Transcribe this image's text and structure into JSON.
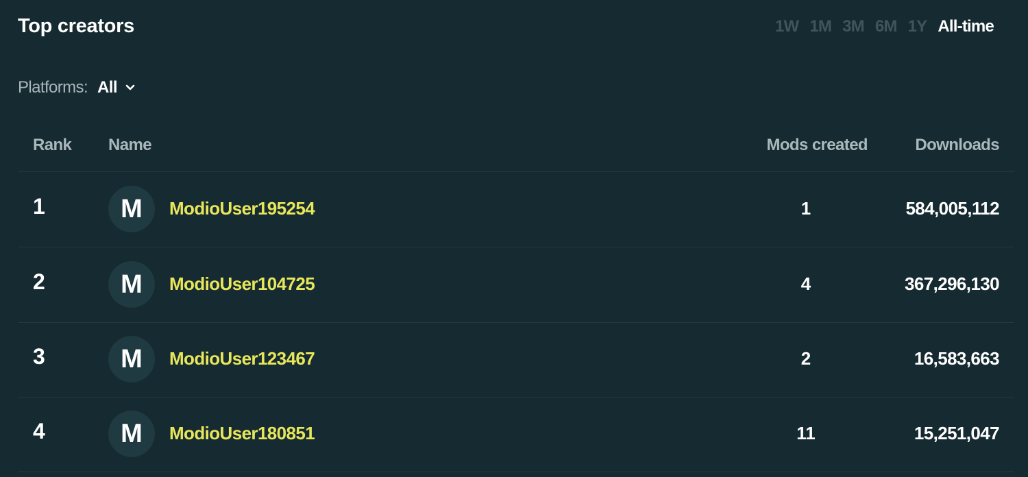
{
  "header": {
    "title": "Top creators",
    "ranges": [
      "1W",
      "1M",
      "3M",
      "6M",
      "1Y",
      "All-time"
    ],
    "active_range": "All-time"
  },
  "filter": {
    "label": "Platforms:",
    "value": "All"
  },
  "table": {
    "columns": {
      "rank": "Rank",
      "name": "Name",
      "mods": "Mods created",
      "downloads": "Downloads"
    },
    "rows": [
      {
        "rank": "1",
        "avatar": "M",
        "name": "ModioUser195254",
        "mods": "1",
        "downloads": "584,005,112"
      },
      {
        "rank": "2",
        "avatar": "M",
        "name": "ModioUser104725",
        "mods": "4",
        "downloads": "367,296,130"
      },
      {
        "rank": "3",
        "avatar": "M",
        "name": "ModioUser123467",
        "mods": "2",
        "downloads": "16,583,663"
      },
      {
        "rank": "4",
        "avatar": "M",
        "name": "ModioUser180851",
        "mods": "11",
        "downloads": "15,251,047"
      }
    ]
  },
  "colors": {
    "background": "#152a31",
    "username": "#e8e65a",
    "inactive_tab": "#3e555c"
  }
}
